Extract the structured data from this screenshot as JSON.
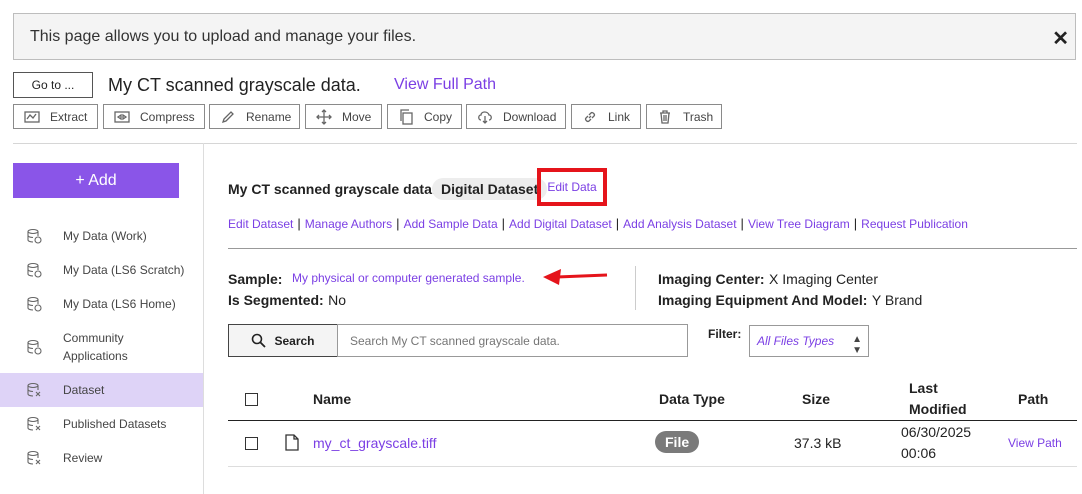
{
  "banner": {
    "text": "This page allows you to upload and manage your files.",
    "close": "✕"
  },
  "header": {
    "goto_label": "Go to ...",
    "title": "My CT scanned grayscale data.",
    "view_full_path": "View Full Path"
  },
  "toolbar": [
    {
      "label": "Extract",
      "icon": "extract-icon"
    },
    {
      "label": "Compress",
      "icon": "compress-icon"
    },
    {
      "label": "Rename",
      "icon": "pencil-icon"
    },
    {
      "label": "Move",
      "icon": "move-icon"
    },
    {
      "label": "Copy",
      "icon": "copy-icon"
    },
    {
      "label": "Download",
      "icon": "download-icon"
    },
    {
      "label": "Link",
      "icon": "link-icon"
    },
    {
      "label": "Trash",
      "icon": "trash-icon"
    }
  ],
  "sidebar": {
    "add_label": "+ Add",
    "items": [
      {
        "label": "My Data (Work)"
      },
      {
        "label": "My Data (LS6 Scratch)"
      },
      {
        "label": "My Data (LS6 Home)"
      },
      {
        "label": "Community Applications"
      },
      {
        "label": "Dataset",
        "active": true
      },
      {
        "label": "Published Datasets"
      },
      {
        "label": "Review"
      }
    ]
  },
  "dataset": {
    "title": "My CT scanned grayscale data.",
    "badge": "Digital Dataset",
    "edit_data": "Edit Data",
    "links": [
      "Edit Dataset",
      "Manage Authors",
      "Add Sample Data",
      "Add Digital Dataset",
      "Add Analysis Dataset",
      "View Tree Diagram",
      "Request Publication"
    ],
    "sample_label": "Sample:",
    "sample_value": "My physical or computer generated sample.",
    "segmented_label": "Is Segmented:",
    "segmented_value": "No",
    "center_label": "Imaging Center:",
    "center_value": "X Imaging Center",
    "equipment_label": "Imaging Equipment And Model:",
    "equipment_value": "Y Brand"
  },
  "search": {
    "button": "Search",
    "placeholder": "Search My CT scanned grayscale data.",
    "filter_label": "Filter:",
    "filter_value": "All Files Types"
  },
  "table": {
    "headers": {
      "name": "Name",
      "data_type": "Data Type",
      "size": "Size",
      "last_modified_1": "Last",
      "last_modified_2": "Modified",
      "path": "Path"
    },
    "rows": [
      {
        "name": "my_ct_grayscale.tiff",
        "data_type": "File",
        "size": "37.3 kB",
        "modified_date": "06/30/2025",
        "modified_time": "00:06",
        "path": "View Path"
      }
    ]
  },
  "colors": {
    "accent": "#7b3fe4",
    "add_button": "#8a55e8",
    "highlight_box": "#e5141b",
    "active_nav": "#ded3f7"
  }
}
